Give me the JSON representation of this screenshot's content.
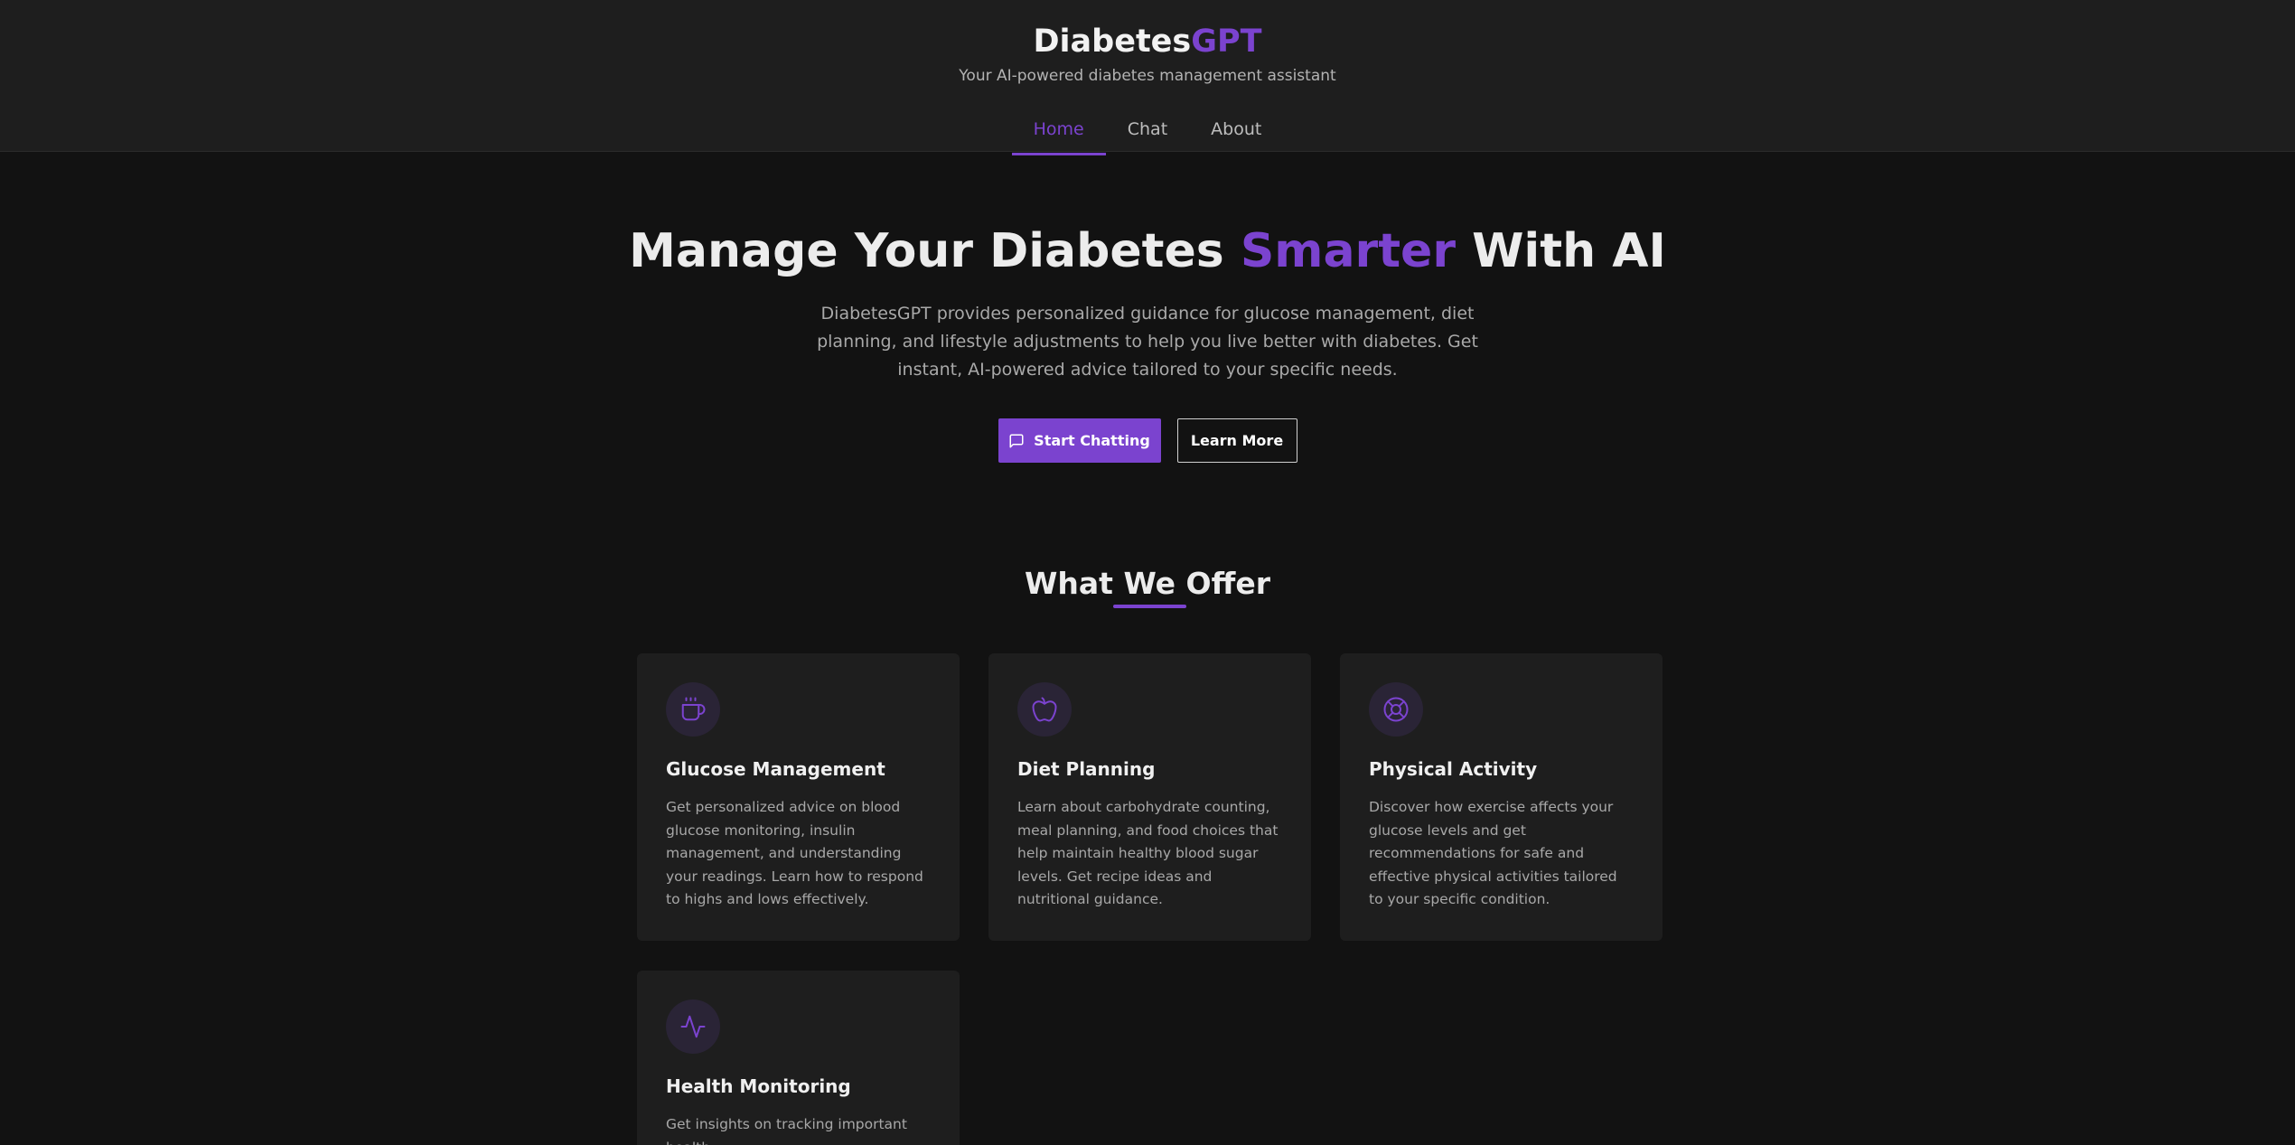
{
  "brand": {
    "name": "Diabetes",
    "accent": "GPT"
  },
  "tagline": "Your AI-powered diabetes management assistant",
  "nav": {
    "items": [
      {
        "label": "Home"
      },
      {
        "label": "Chat"
      },
      {
        "label": "About"
      }
    ],
    "active": "Home"
  },
  "hero": {
    "title_pre": "Manage Your Diabetes ",
    "title_accent": "Smarter",
    "title_post": " With AI",
    "description": "DiabetesGPT provides personalized guidance for glucose management, diet planning, and lifestyle adjustments to help you live better with diabetes. Get instant, AI-powered advice tailored to your specific needs.",
    "primary_button": "Start Chatting",
    "secondary_button": "Learn More"
  },
  "section": {
    "title": "What We Offer"
  },
  "features": [
    {
      "icon": "coffee-cup-icon",
      "title": "Glucose Management",
      "description": "Get personalized advice on blood glucose monitoring, insulin management, and understanding your readings. Learn how to respond to highs and lows effectively."
    },
    {
      "icon": "apple-icon",
      "title": "Diet Planning",
      "description": "Learn about carbohydrate counting, meal planning, and food choices that help maintain healthy blood sugar levels. Get recipe ideas and nutritional guidance."
    },
    {
      "icon": "lifebuoy-icon",
      "title": "Physical Activity",
      "description": "Discover how exercise affects your glucose levels and get recommendations for safe and effective physical activities tailored to your specific condition."
    },
    {
      "icon": "activity-pulse-icon",
      "title": "Health Monitoring",
      "description": "Get insights on tracking important health"
    }
  ],
  "colors": {
    "accent": "#7b43cf",
    "background": "#121212",
    "surface": "#1e1e1e",
    "icon_bg": "#2a2436"
  }
}
